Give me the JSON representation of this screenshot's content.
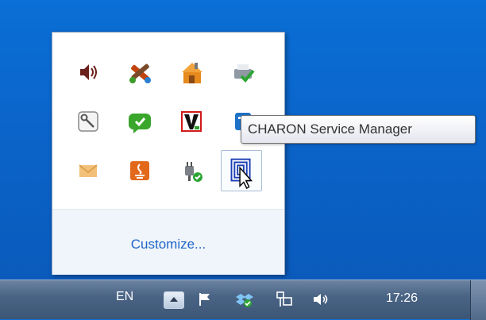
{
  "tray_overflow": {
    "customize_label": "Customize...",
    "icons": [
      {
        "name": "speaker-icon"
      },
      {
        "name": "tools-crossed-icon"
      },
      {
        "name": "house-orange-icon"
      },
      {
        "name": "printer-check-icon"
      },
      {
        "name": "key-icon"
      },
      {
        "name": "green-chat-icon"
      },
      {
        "name": "v-logo-icon"
      },
      {
        "name": "blue-app-partial-icon"
      },
      {
        "name": "envelope-icon"
      },
      {
        "name": "java-icon"
      },
      {
        "name": "plug-check-icon"
      },
      {
        "name": "charon-service-manager-icon"
      }
    ]
  },
  "tooltip": {
    "text": "CHARON Service Manager"
  },
  "taskbar": {
    "language": "EN",
    "show_hidden_icon": "chevron-up-icon",
    "clock": "17:26"
  },
  "colors": {
    "desktop": "#0a63c8",
    "link": "#1f66c8",
    "taskbar": "#4a6485"
  }
}
